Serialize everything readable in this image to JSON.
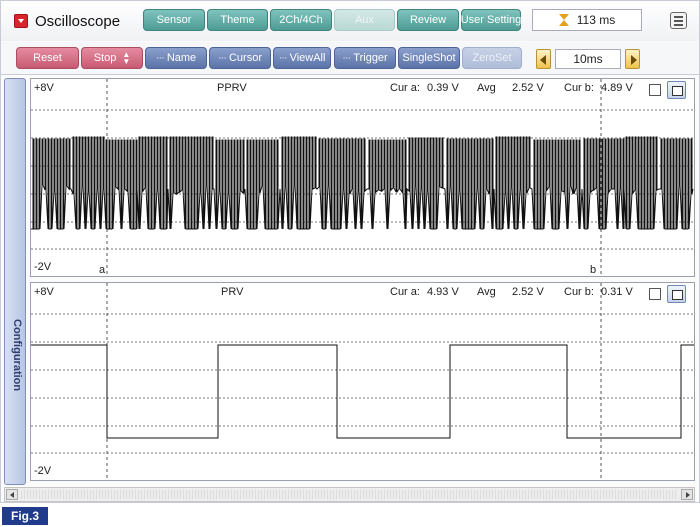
{
  "app": {
    "title": "Oscilloscope"
  },
  "top_tabs": [
    {
      "label": "Sensor",
      "disabled": false
    },
    {
      "label": "Theme",
      "disabled": false
    },
    {
      "label": "2Ch/4Ch",
      "disabled": false
    },
    {
      "label": "Aux",
      "disabled": true
    },
    {
      "label": "Review",
      "disabled": false
    },
    {
      "label": "User Setting",
      "disabled": false
    }
  ],
  "time_readout": "113 ms",
  "toolbar": {
    "reset": "Reset",
    "stop": "Stop",
    "name": "Name",
    "cursor": "Cursor",
    "viewall": "ViewAll",
    "trigger": "Trigger",
    "singleshot": "SingleShot",
    "zeroset": "ZeroSet",
    "timebase": "10ms"
  },
  "side_tab": "Configuration",
  "channels": [
    {
      "name": "PPRV",
      "y_max": "+8V",
      "y_min": "-2V",
      "cur_a_label": "Cur a:",
      "cur_a": "0.39 V",
      "avg_label": "Avg",
      "avg": "2.52 V",
      "cur_b_label": "Cur b:",
      "cur_b": "4.89 V",
      "cursor_a_marker": "a",
      "cursor_b_marker": "b"
    },
    {
      "name": "PRV",
      "y_max": "+8V",
      "y_min": "-2V",
      "cur_a_label": "Cur a:",
      "cur_a": "4.93 V",
      "avg_label": "Avg",
      "avg": "2.52 V",
      "cur_b_label": "Cur b:",
      "cur_b": "0.31 V"
    }
  ],
  "figure_label": "Fig.3",
  "colors": {
    "tab_teal": "#5fa9a3",
    "button_red": "#d06a82",
    "button_blue": "#6a80b5",
    "figure_label_bg": "#203a8c",
    "trace": "#111111"
  },
  "icons": [
    "menu-dropdown-icon",
    "hourglass-icon",
    "list-icon",
    "left-arrow-icon",
    "right-arrow-icon",
    "checkbox-icon",
    "fullscreen-icon"
  ]
}
